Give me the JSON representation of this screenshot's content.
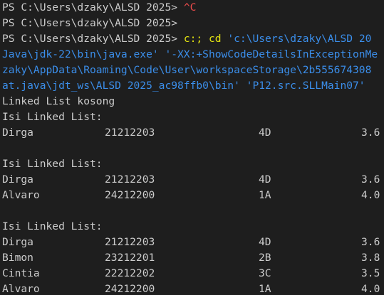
{
  "terminal": {
    "prompt": "PS C:\\Users\\dzaky\\ALSD 2025>",
    "interrupt": "^C",
    "command": {
      "part1": "c:;",
      "part2": "cd",
      "path_arg": "'c:\\Users\\dzaky\\ALSD 20",
      "wrap1": "Java\\jdk-22\\bin\\java.exe' '-XX:+ShowCodeDetailsInExceptionMe",
      "wrap2": "zaky\\AppData\\Roaming\\Code\\User\\workspaceStorage\\2b555674308",
      "wrap3": "at.java\\jdt_ws\\ALSD 2025_ac98ffb0\\bin' 'P12.src.SLLMain07'"
    },
    "output": {
      "empty_msg": "Linked List kosong",
      "header": "Isi Linked List:",
      "block1": [
        {
          "name": "Dirga",
          "nim": "21212203",
          "class": "4D",
          "ipk": "3.6"
        }
      ],
      "block2": [
        {
          "name": "Dirga",
          "nim": "21212203",
          "class": "4D",
          "ipk": "3.6"
        },
        {
          "name": "Alvaro",
          "nim": "24212200",
          "class": "1A",
          "ipk": "4.0"
        }
      ],
      "block3": [
        {
          "name": "Dirga",
          "nim": "21212203",
          "class": "4D",
          "ipk": "3.6"
        },
        {
          "name": "Bimon",
          "nim": "23212201",
          "class": "2B",
          "ipk": "3.8"
        },
        {
          "name": "Cintia",
          "nim": "22212202",
          "class": "3C",
          "ipk": "3.5"
        },
        {
          "name": "Alvaro",
          "nim": "24212200",
          "class": "1A",
          "ipk": "4.0"
        }
      ]
    },
    "colors": {
      "background": "#1e1e1e",
      "text": "#cccccc",
      "interrupt": "#f14c4c",
      "command": "#e5e510",
      "string": "#3b8eea"
    }
  }
}
